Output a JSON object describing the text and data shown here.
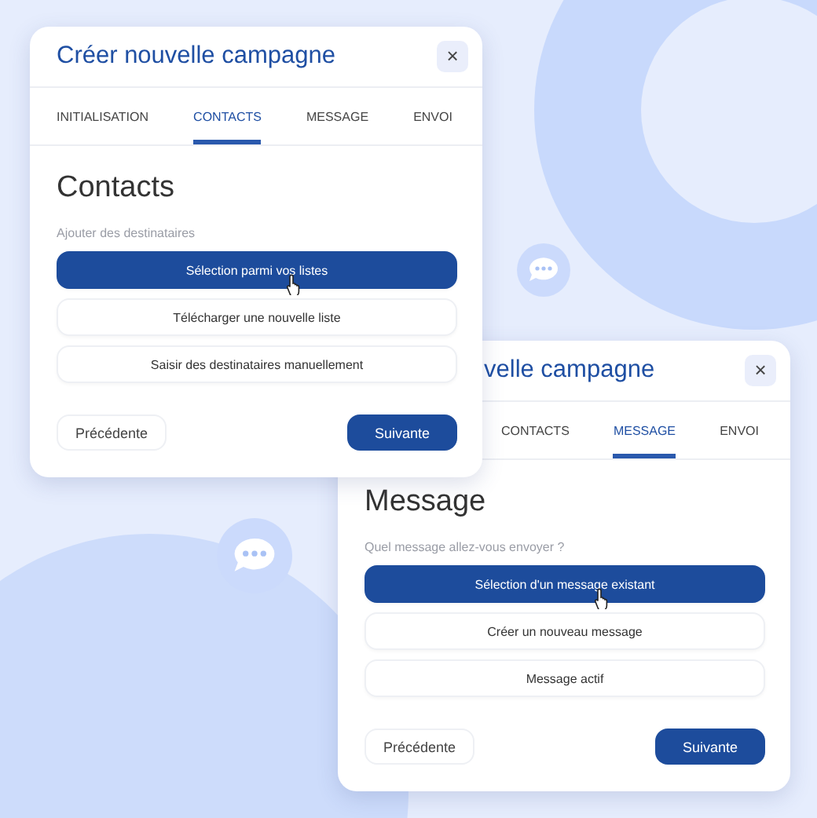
{
  "dialogs": [
    {
      "title": "Créer nouvelle campagne",
      "close": "×",
      "tabs": [
        {
          "label": "INITIALISATION",
          "selected": false
        },
        {
          "label": "CONTACTS",
          "selected": true
        },
        {
          "label": "MESSAGE",
          "selected": false
        },
        {
          "label": "ENVOI",
          "selected": false
        }
      ],
      "heading": "Contacts",
      "prompt": "Ajouter des destinataires",
      "options": [
        {
          "label": "Sélection parmi vos listes",
          "selected": true
        },
        {
          "label": "Télécharger une nouvelle liste",
          "selected": false
        },
        {
          "label": "Saisir des destinataires manuellement",
          "selected": false
        }
      ],
      "back": "Précédente",
      "next": "Suivante"
    },
    {
      "title": "velle campagne",
      "close": "×",
      "tabs": [
        {
          "label": "CONTACTS",
          "selected": false
        },
        {
          "label": "MESSAGE",
          "selected": true
        },
        {
          "label": "ENVOI",
          "selected": false
        }
      ],
      "heading": "Message",
      "prompt": "Quel message allez-vous envoyer ?",
      "options": [
        {
          "label": "Sélection d'un message existant",
          "selected": true
        },
        {
          "label": "Créer un nouveau message",
          "selected": false
        },
        {
          "label": "Message actif",
          "selected": false
        }
      ],
      "back": "Précédente",
      "next": "Suivante"
    }
  ]
}
